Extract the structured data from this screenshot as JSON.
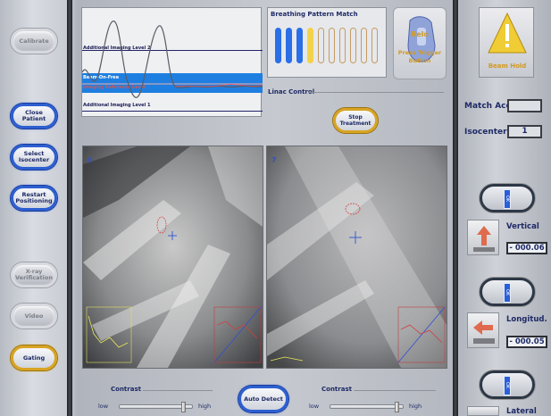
{
  "left_nav": {
    "calibrate": "Calibrate",
    "close_patient": "Close Patient",
    "select_isocenter": "Select\nIsocenter",
    "restart_positioning": "Restart\nPositioning",
    "xray_verification": "X-ray\nVerification",
    "video": "Video",
    "gating": "Gating"
  },
  "breathing_graph": {
    "level2": "Additional Imaging Level 2",
    "beam_on_free": "Beam-On-Free",
    "imaging_level": "Imaging Reference Level",
    "level1": "Additional Imaging Level 1"
  },
  "breathing_match": {
    "title": "Breathing Pattern Match",
    "bars": [
      "blue",
      "blue",
      "blue",
      "yellow",
      "off",
      "off",
      "off",
      "off",
      "off",
      "off"
    ]
  },
  "relocate": {
    "label": "Relo",
    "line1": "Press Trigger",
    "line2": "Button"
  },
  "linac": {
    "label": "Linac Control",
    "stop_button": "Stop\nTreatment"
  },
  "xray": {
    "left_number": "6",
    "right_number": "7"
  },
  "bottom": {
    "contrast_label": "Contrast",
    "low": "low",
    "high": "high",
    "auto_detect": "Auto Detect",
    "left_slider_value": 0.88,
    "right_slider_value": 0.92
  },
  "right_panel": {
    "beam_hold": "Beam Hold",
    "match_acc_label": "Match Acc",
    "match_acc_value": "",
    "isocenter_label": "Isocenter",
    "isocenter_value": "1",
    "ok_label": "OK",
    "axes": [
      {
        "name": "Vertical",
        "value": "- 000.06"
      },
      {
        "name": "Longitud.",
        "value": "- 000.05"
      },
      {
        "name": "Lateral",
        "value": ""
      }
    ]
  },
  "colors": {
    "accent_blue": "#2d5fd0",
    "accent_gold": "#d8a423",
    "text_navy": "#1e2a66"
  }
}
